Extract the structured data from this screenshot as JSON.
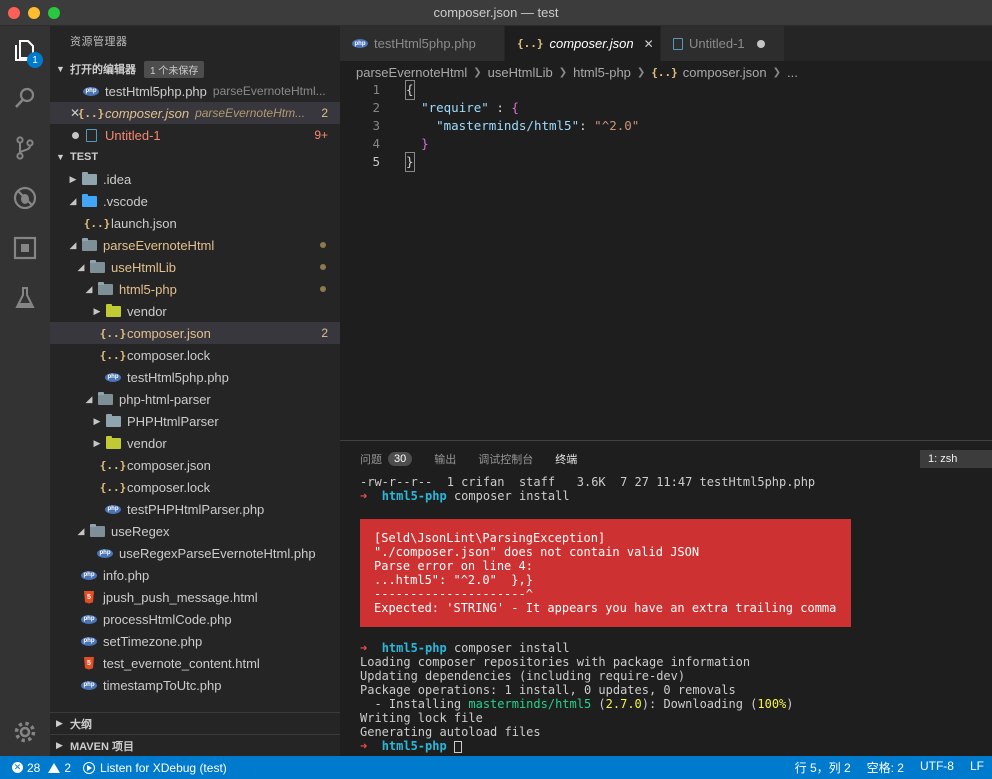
{
  "window": {
    "title": "composer.json — test"
  },
  "activity": {
    "explorer_badge": "1"
  },
  "sidebar": {
    "title": "资源管理器",
    "open_editors": {
      "label": "打开的编辑器",
      "unsaved_badge": "1 个未保存",
      "items": [
        {
          "name": "testHtml5php.php",
          "desc": "parseEvernoteHtml...",
          "count": ""
        },
        {
          "name": "composer.json",
          "desc": "parseEvernoteHtm...",
          "count": "2"
        },
        {
          "name": "Untitled-1",
          "desc": "",
          "count": "9+"
        }
      ]
    },
    "workspace": {
      "label": "TEST",
      "items": [
        {
          "name": ".idea"
        },
        {
          "name": ".vscode"
        },
        {
          "name": "launch.json"
        },
        {
          "name": "parseEvernoteHtml"
        },
        {
          "name": "useHtmlLib"
        },
        {
          "name": "html5-php"
        },
        {
          "name": "vendor"
        },
        {
          "name": "composer.json",
          "count": "2"
        },
        {
          "name": "composer.lock"
        },
        {
          "name": "testHtml5php.php"
        },
        {
          "name": "php-html-parser"
        },
        {
          "name": "PHPHtmlParser"
        },
        {
          "name": "vendor"
        },
        {
          "name": "composer.json"
        },
        {
          "name": "composer.lock"
        },
        {
          "name": "testPHPHtmlParser.php"
        },
        {
          "name": "useRegex"
        },
        {
          "name": "useRegexParseEvernoteHtml.php"
        },
        {
          "name": "info.php"
        },
        {
          "name": "jpush_push_message.html"
        },
        {
          "name": "processHtmlCode.php"
        },
        {
          "name": "setTimezone.php"
        },
        {
          "name": "test_evernote_content.html"
        },
        {
          "name": "timestampToUtc.php"
        }
      ]
    },
    "outline_label": "大纲",
    "maven_label": "MAVEN 项目"
  },
  "editor": {
    "tabs": [
      {
        "label": "testHtml5php.php"
      },
      {
        "label": "composer.json"
      },
      {
        "label": "Untitled-1"
      }
    ],
    "breadcrumb": [
      "parseEvernoteHtml",
      "useHtmlLib",
      "html5-php",
      "composer.json",
      "..."
    ],
    "lines": [
      {
        "n": "1",
        "text": "{"
      },
      {
        "n": "2",
        "key": "\"require\"",
        "mid": " : ",
        "open": "{"
      },
      {
        "n": "3",
        "key": "\"masterminds/html5\"",
        "mid": ": ",
        "val": "\"^2.0\""
      },
      {
        "n": "4",
        "close": "}"
      },
      {
        "n": "5",
        "text": "}"
      }
    ]
  },
  "panel": {
    "tabs": [
      {
        "label": "问题",
        "count": "30"
      },
      {
        "label": "输出"
      },
      {
        "label": "调试控制台"
      },
      {
        "label": "终端"
      }
    ],
    "shell": "1: zsh",
    "terminal": {
      "ls_line": "-rw-r--r--  1 crifan  staff   3.6K  7 27 11:47 testHtml5php.php",
      "prompt_dir": "html5-php",
      "cmd": " composer install",
      "error": [
        "[Seld\\JsonLint\\ParsingException]",
        "\"./composer.json\" does not contain valid JSON",
        "Parse error on line 4:",
        "...html5\": \"^2.0\"  },}",
        "---------------------^",
        "Expected: 'STRING' - It appears you have an extra trailing comma"
      ],
      "out1": "Loading composer repositories with package information",
      "out2": "Updating dependencies (including require-dev)",
      "out3": "Package operations: 1 install, 0 updates, 0 removals",
      "install_prefix": "  - Installing ",
      "install_pkg": "masterminds/html5",
      "install_ver_open": " (",
      "install_ver": "2.7.0",
      "install_mid": "): Downloading (",
      "install_pct": "100%",
      "install_close": ")",
      "out5": "Writing lock file",
      "out6": "Generating autoload files"
    }
  },
  "status": {
    "errors": "28",
    "warnings": "2",
    "debug": "Listen for XDebug (test)",
    "position": "行 5，列 2",
    "indent": "空格: 2",
    "encoding": "UTF-8",
    "eol": "LF"
  },
  "colors": {
    "accent": "#007acc",
    "error_bg": "#cd3131",
    "modified": "#e2c08d"
  }
}
